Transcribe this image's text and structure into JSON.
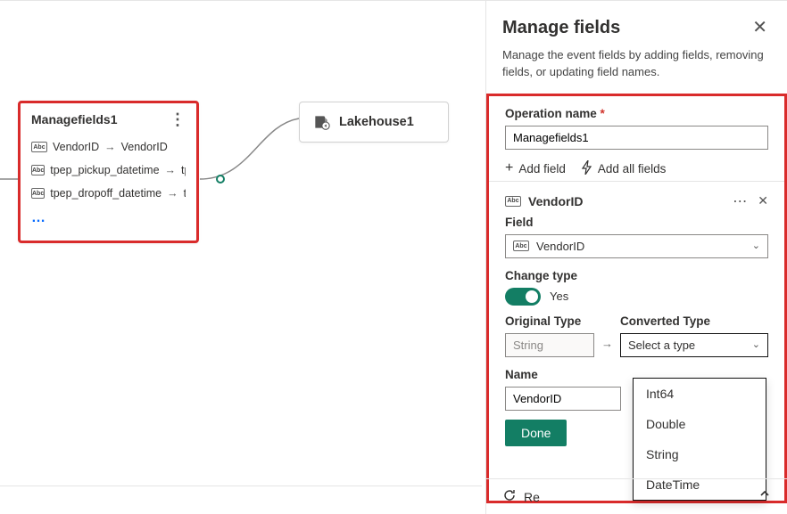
{
  "canvas": {
    "node1": {
      "title": "Managefields1",
      "rows": [
        {
          "src": "VendorID",
          "dst": "VendorID"
        },
        {
          "src": "tpep_pickup_datetime",
          "dst": "tpe"
        },
        {
          "src": "tpep_dropoff_datetime",
          "dst": "tp"
        }
      ]
    },
    "node2": {
      "title": "Lakehouse1"
    }
  },
  "panel": {
    "title": "Manage fields",
    "desc": "Manage the event fields by adding fields, removing fields, or updating field names.",
    "opname_label": "Operation name",
    "opname_value": "Managefields1",
    "add_field": "Add field",
    "add_all": "Add all fields",
    "field_block": {
      "heading": "VendorID",
      "field_label": "Field",
      "field_value": "VendorID",
      "change_type_label": "Change type",
      "toggle_value": "Yes",
      "orig_label": "Original Type",
      "orig_value": "String",
      "conv_label": "Converted Type",
      "conv_placeholder": "Select a type",
      "name_label": "Name",
      "name_value": "VendorID",
      "done": "Done",
      "type_options": [
        "Int64",
        "Double",
        "String",
        "DateTime"
      ]
    },
    "refresh": "Re"
  }
}
